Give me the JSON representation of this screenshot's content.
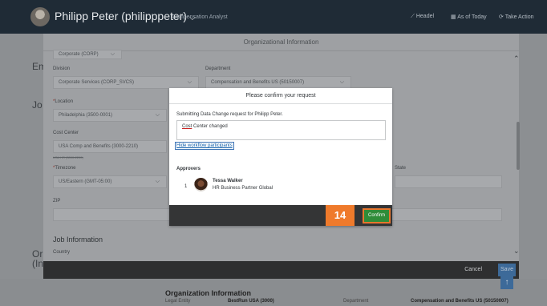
{
  "shell": {
    "user_name": "Philipp Peter (philipppeter)",
    "user_chevron": "⌵",
    "role": "Compensation Analyst",
    "headel": "Headel",
    "as_of": "As of Today",
    "take_action": "Take Action"
  },
  "background": {
    "left_labels": [
      "Em",
      "Jo",
      "Or",
      "(In"
    ],
    "bottom_title": "Organization Information",
    "bottom_row": [
      "Legal Entity",
      "BestRun USA (3000)",
      "Department",
      "Compensation and Benefits US (50150007)"
    ]
  },
  "org_dialog": {
    "title": "Organizational Information",
    "partial_top_value": "Corporate (CORP)",
    "division_label": "Division",
    "division_value": "Corporate Services (CORP_SVCS)",
    "department_label": "Department",
    "department_value": "Compensation and Benefits US (50150007)",
    "location_label": "Location",
    "location_value": "Philadelphia (3500-0001)",
    "cost_center_label": "Cost Center",
    "cost_center_value": "USA Comp and Benefits (3000-2210)",
    "cost_center_old": "USA HR (3000-2200)",
    "timezone_label": "Timezone",
    "timezone_value": "US/Eastern (GMT-05:00)",
    "zip_label": "ZIP",
    "state_label": "State",
    "job_info_title": "Job Information",
    "country_label": "Country",
    "cancel": "Cancel",
    "save": "Save",
    "required_mark": "*"
  },
  "modal": {
    "title": "Please confirm your request",
    "subtitle": "Submitting Data Change request for Philipp Peter.",
    "comment_word": "Cost",
    "comment_rest": " Center changed",
    "hide_link": "Hide workflow participants",
    "approvers_heading": "Approvers",
    "approver": {
      "number": "1",
      "name": "Tessa Walker",
      "role": "HR Business Partner Global"
    },
    "confirm": "Confirm"
  },
  "tutorial_step": "14",
  "icons": {
    "scroll_up": "⌃",
    "scroll_down": "⌄",
    "dropdown": "⌵",
    "back_to_top": "↑"
  }
}
